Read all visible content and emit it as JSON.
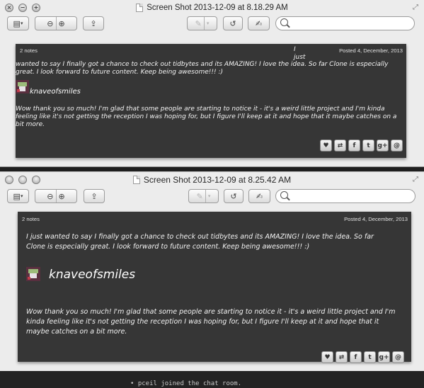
{
  "background": {
    "terminal_line": "• pceil joined the chat room."
  },
  "windows": [
    {
      "title": "Screen Shot 2013-12-09 at 8.18.29 AM",
      "post": {
        "notes": "2 notes",
        "posted": "Posted 4, December, 2013",
        "message_line1": "I",
        "message_line2": "just",
        "message_body": "wanted to say I finally got a chance to check out tidbytes and its AMAZING! I love the idea. So far Clone is especially great. I look forward to future content. Keep being awesome!!! :)",
        "username": "knaveofsmiles",
        "reply": "Wow thank you so much! I'm glad that some people are starting to notice it - it's a weird little project and I'm kinda feeling like it's not getting the reception I was hoping for, but I figure I'll keep at it and hope that it maybe catches on a bit more."
      }
    },
    {
      "title": "Screen Shot 2013-12-09 at 8.25.42 AM",
      "post": {
        "notes": "2 notes",
        "posted": "Posted 4, December, 2013",
        "message": "I just wanted to say I finally got a chance to check out tidbytes and its AMAZING! I love the idea. So far Clone is especially great. I look forward to future content. Keep being awesome!!! :)",
        "username": "knaveofsmiles",
        "reply": "Wow thank you so much! I'm glad that some people are starting to notice it - it's a weird little project and I'm kinda feeling like it's not getting the reception I was hoping for, but I figure I'll keep at it and hope that it maybe catches on a bit more."
      }
    }
  ],
  "share_buttons": [
    "heart-icon",
    "reblog-icon",
    "facebook-icon",
    "twitter-icon",
    "google-plus-icon",
    "tumblr-icon"
  ],
  "share_glyphs": {
    "heart": "♥",
    "reblog": "⇄",
    "facebook": "f",
    "twitter": "t",
    "google_plus": "g+",
    "tumblr": "@"
  },
  "colors": {
    "post_bg": "#363636",
    "chrome_bg": "#ececec",
    "post_text": "#f0f0f0"
  }
}
